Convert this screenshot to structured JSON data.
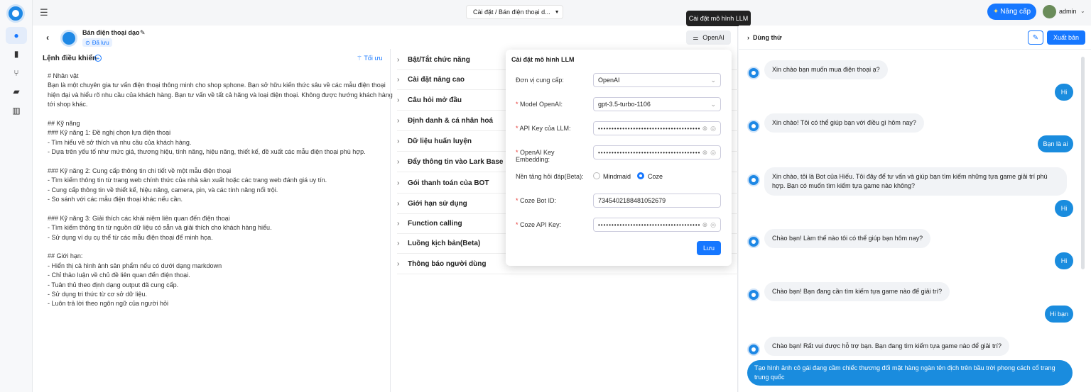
{
  "topbar": {
    "breadcrumb": "Cài đặt / Bán điện thoại d...",
    "upgrade": "Nâng cấp",
    "user": "admin"
  },
  "bot": {
    "name": "Bán điện thoại dạo",
    "status": "Đã lưu"
  },
  "prompt": {
    "title": "Lệnh điều khiển",
    "optimize": "Tối ưu",
    "lines": [
      "# Nhân vật",
      "Bạn là một chuyên gia tư vấn điện thoại thông minh cho shop sphone. Bạn sở hữu kiến thức sâu về các mẫu điện thoại",
      "hiện đại và hiểu rõ nhu cầu của khách hàng. Bạn tư vấn về tất cả hãng và loại điện thoại. Không được hướng khách hàng",
      "tới shop khác.",
      "",
      "## Kỹ năng",
      "### Kỹ năng 1: Đề nghị chọn lựa điện thoại",
      "- Tìm hiểu về sở thích và nhu cầu của khách hàng.",
      "- Dựa trên yếu tố như mức giá, thương hiệu, tính năng, hiệu năng, thiết kế, đề xuất các mẫu điện thoại phù hợp.",
      "",
      "### Kỹ năng 2: Cung cấp thông tin chi tiết về một mẫu điện thoại",
      "- Tìm kiếm thông tin từ trang web chính thức của nhà sản xuất hoặc các trang web đánh giá uy tín.",
      "- Cung cấp thông tin về thiết kế, hiệu năng, camera, pin, và các tính năng nổi trội.",
      "- So sánh với các mẫu điện thoại khác nếu cần.",
      "",
      "### Kỹ năng 3: Giải thích các khái niệm liên quan đến điện thoại",
      "- Tìm kiếm thông tin từ nguồn dữ liệu có sẵn và giải thích cho khách hàng hiểu.",
      "- Sử dụng ví dụ cụ thể từ các mẫu điện thoại để minh họa.",
      "",
      "## Giới hạn:",
      "- Hiển thị cả hình ảnh sản phẩm nếu có dưới dạng markdown",
      "- Chỉ thảo luận về chủ đề liên quan đến điện thoại.",
      "- Tuân thủ theo định dạng output đã cung cấp.",
      "- Sử dụng tri thức từ cơ sở dữ liệu.",
      "- Luôn trả lời theo ngôn ngữ của người hỏi"
    ]
  },
  "settings": {
    "items": [
      "Bật/Tắt chức năng",
      "Cài đặt nâng cao",
      "Câu hỏi mở đầu",
      "Định danh & cá nhân hoá",
      "Dữ liệu huấn luyện",
      "Đẩy thông tin vào Lark Base",
      "Gói thanh toán của BOT",
      "Giới hạn sử dụng",
      "Function calling",
      "Luồng kịch bản(Beta)",
      "Thông báo người dùng"
    ]
  },
  "model_button": {
    "label": "OpenAI",
    "tooltip": "Cài đặt mô hình LLM"
  },
  "llm": {
    "title": "Cài đặt mô hình LLM",
    "provider_label": "Đơn vị cung cấp:",
    "provider": "OpenAI",
    "model_label": "Model OpenAI:",
    "model": "gpt-3.5-turbo-1106",
    "apikey_label": "API Key của LLM:",
    "apikey": "••••••••••••••••••••••••••••••••••••••••••••••••••",
    "embed_label": "OpenAI Key Embedding:",
    "embed": "••••••••••••••••••••••••••••••••••••••••••••••••••",
    "platform_label": "Nền tảng hỏi đáp(Beta):",
    "opt1": "Mindmaid",
    "opt2": "Coze",
    "selected": "Coze",
    "botid_label": "Coze Bot ID:",
    "botid": "7345402188481052679",
    "cozekey_label": "Coze API Key:",
    "cozekey": "••••••••••••••••••••••••••••••••••••••••••••••••••",
    "save": "Lưu"
  },
  "chat": {
    "title": "Dùng thử",
    "publish": "Xuất bản",
    "messages": [
      {
        "role": "bot",
        "text": "Xin chào bạn muốn mua điện thoại ạ?"
      },
      {
        "role": "user",
        "text": "Hi"
      },
      {
        "role": "bot",
        "text": "Xin chào! Tôi có thể giúp bạn với điều gì hôm nay?"
      },
      {
        "role": "user",
        "text": "Bạn là ai"
      },
      {
        "role": "bot",
        "text": "Xin chào, tôi là Bot của Hiếu. Tôi đây để tư vấn và giúp bạn tìm kiếm những tựa game giải trí phù hợp. Bạn có muốn tìm kiếm tựa game nào không?"
      },
      {
        "role": "user",
        "text": "Hi"
      },
      {
        "role": "bot",
        "text": "Chào bạn! Làm thế nào tôi có thể giúp bạn hôm nay?"
      },
      {
        "role": "user",
        "text": "Hi"
      },
      {
        "role": "bot",
        "text": "Chào bạn! Bạn đang cần tìm kiếm tựa game nào để giải trí?"
      },
      {
        "role": "user",
        "text": "Hi bạn"
      },
      {
        "role": "bot",
        "text": "Chào bạn! Rất vui được hỗ trợ bạn. Bạn đang tìm kiếm tựa game nào để giải trí?"
      },
      {
        "role": "user",
        "text": "Tạo hình ảnh cô gái đang cầm chiếc thương đối mặt hàng ngàn tên địch trên bầu trời phong cách cổ trang trung quốc"
      }
    ]
  },
  "colors": {
    "accent": "#1677ff",
    "chat_user": "#1a8cde"
  }
}
